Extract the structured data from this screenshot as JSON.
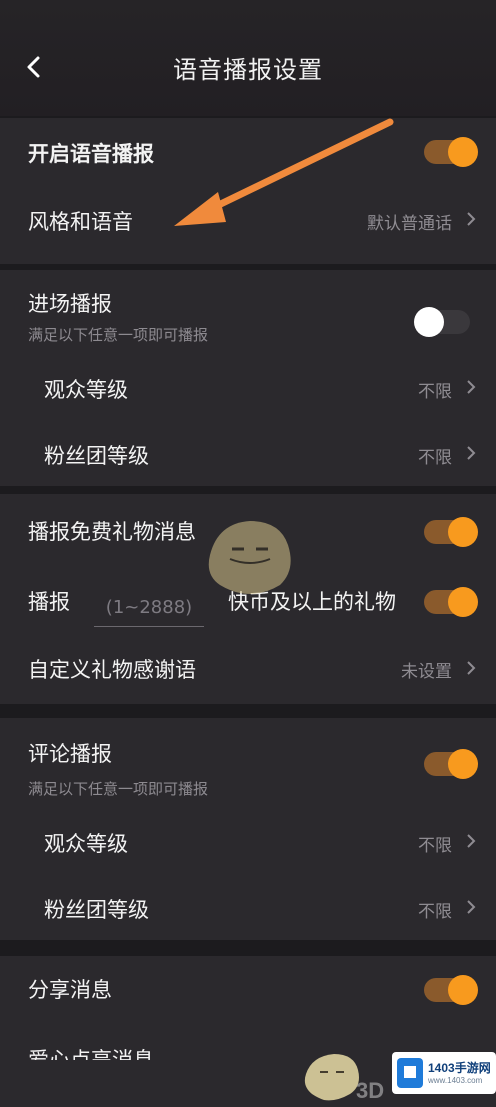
{
  "header": {
    "back_icon": "chevron-left-icon",
    "title": "语音播报设置"
  },
  "voice": {
    "enable_label": "开启语音播报",
    "enable_on": true,
    "style_label": "风格和语音",
    "style_value": "默认普通话"
  },
  "entry": {
    "label": "进场播报",
    "sub": "满足以下任意一项即可播报",
    "on": false,
    "audience_label": "观众等级",
    "audience_value": "不限",
    "fan_label": "粉丝团等级",
    "fan_value": "不限"
  },
  "gift": {
    "free_label": "播报免费礼物消息",
    "free_on": true,
    "broadcast_label": "播报",
    "amount_placeholder": "(1~2888)",
    "broadcast_suffix": "快币及以上的礼物",
    "broadcast_on": true,
    "thanks_label": "自定义礼物感谢语",
    "thanks_value": "未设置"
  },
  "comment": {
    "label": "评论播报",
    "sub": "满足以下任意一项即可播报",
    "on": true,
    "audience_label": "观众等级",
    "audience_value": "不限",
    "fan_label": "粉丝团等级",
    "fan_value": "不限"
  },
  "share": {
    "label": "分享消息",
    "on": true
  },
  "partial": {
    "label": "爱心点亮消息"
  },
  "watermark": {
    "text_3d": "3D",
    "site_name": "1403手游网",
    "site_url": "www.1403.com"
  },
  "colors": {
    "accent": "#f89a1e",
    "background": "#1c1b1e",
    "section": "#2b292d",
    "annotation_arrow": "#f08a3c"
  }
}
